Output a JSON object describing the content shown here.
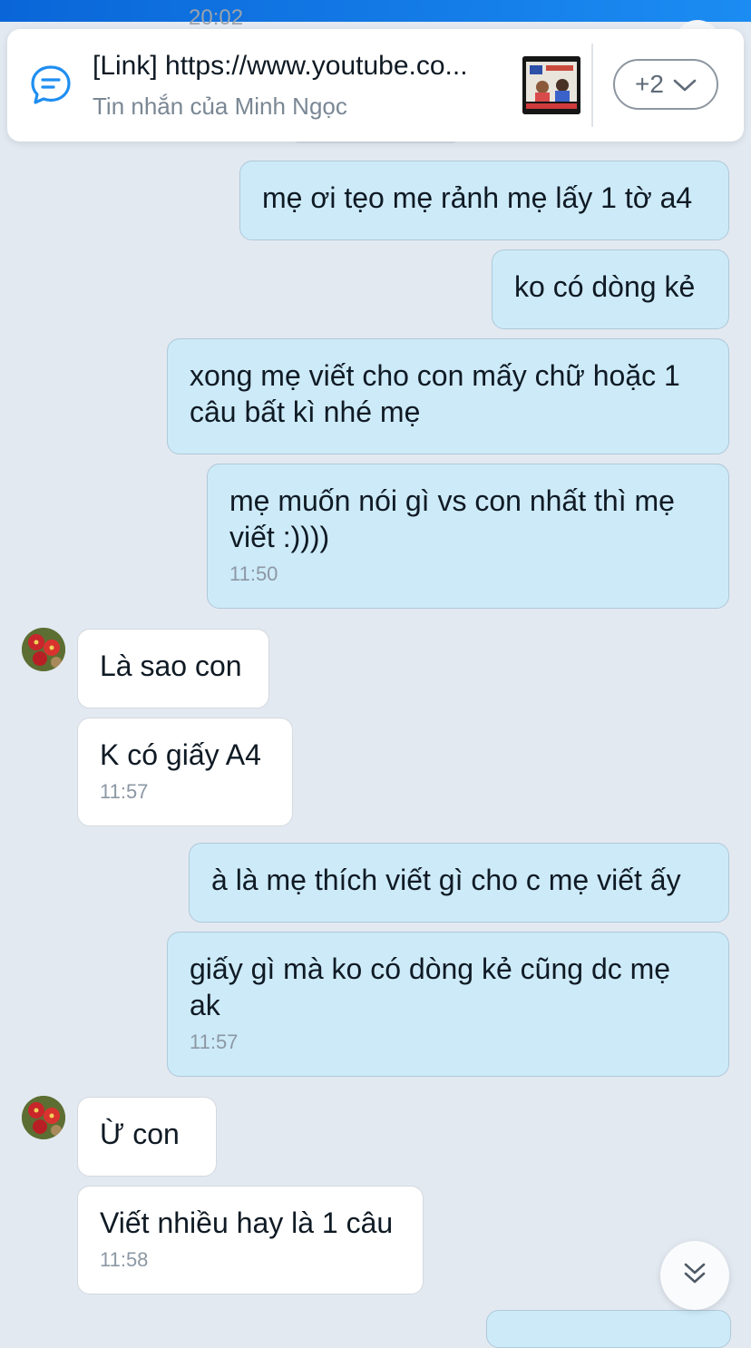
{
  "status": {
    "ghost_time": "20:02"
  },
  "pinned": {
    "title": "[Link] https://www.youtube.co...",
    "subtitle": "Tin nhắn của Minh Ngọc",
    "more_label": "+2"
  },
  "messages": [
    {
      "text": "mẹ ơi tẹo mẹ rảnh mẹ lấy 1 tờ a4",
      "time": ""
    },
    {
      "text": "ko có dòng kẻ",
      "time": ""
    },
    {
      "text": "xong mẹ viết cho con mấy chữ hoặc 1 câu bất kì nhé mẹ",
      "time": ""
    },
    {
      "text": "mẹ muốn nói gì vs con nhất thì mẹ viết :))))",
      "time": "11:50"
    },
    {
      "text": "Là sao con",
      "time": ""
    },
    {
      "text": "K có giấy A4",
      "time": "11:57"
    },
    {
      "text": "à là mẹ thích viết gì cho c mẹ viết ấy",
      "time": ""
    },
    {
      "text": "giấy gì mà ko có dòng kẻ cũng dc mẹ ak",
      "time": "11:57"
    },
    {
      "text": "Ừ con",
      "time": ""
    },
    {
      "text": "Viết nhiều hay là 1 câu",
      "time": "11:58"
    }
  ],
  "icons": {
    "pin": "chat-bubble-icon",
    "more": "chevron-down-icon",
    "scroll": "double-chevron-down-icon"
  },
  "colors": {
    "header": "#1b8cf2",
    "background": "#e3e9f1",
    "outgoing_bubble": "#cdeaf8",
    "incoming_bubble": "#ffffff"
  }
}
